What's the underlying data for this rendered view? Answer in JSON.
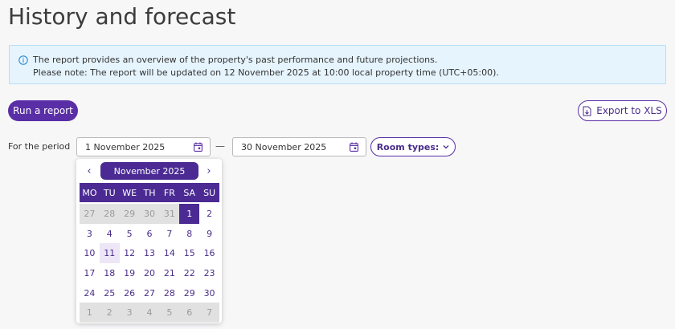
{
  "page": {
    "title": "History and forecast"
  },
  "info": {
    "line1": "The report provides an overview of the property's past performance and future projections.",
    "line2": "Please note: The report will be updated on 12 November 2025 at 10:00 local property time (UTC+05:00)."
  },
  "toolbar": {
    "run_label": "Run a report",
    "export_label": "Export to XLS"
  },
  "period": {
    "label": "For the period",
    "from": "1 November 2025",
    "separator": "—",
    "to": "30 November 2025",
    "room_types_label": "Room types:"
  },
  "calendar": {
    "prev": "‹",
    "next": "›",
    "month": "November 2025",
    "weekdays": [
      "MO",
      "TU",
      "WE",
      "TH",
      "FR",
      "SA",
      "SU"
    ],
    "days": [
      {
        "d": "27",
        "t": "other"
      },
      {
        "d": "28",
        "t": "other"
      },
      {
        "d": "29",
        "t": "other"
      },
      {
        "d": "30",
        "t": "other"
      },
      {
        "d": "31",
        "t": "other"
      },
      {
        "d": "1",
        "t": "selected"
      },
      {
        "d": "2",
        "t": ""
      },
      {
        "d": "3",
        "t": ""
      },
      {
        "d": "4",
        "t": ""
      },
      {
        "d": "5",
        "t": ""
      },
      {
        "d": "6",
        "t": ""
      },
      {
        "d": "7",
        "t": ""
      },
      {
        "d": "8",
        "t": ""
      },
      {
        "d": "9",
        "t": ""
      },
      {
        "d": "10",
        "t": ""
      },
      {
        "d": "11",
        "t": "today"
      },
      {
        "d": "12",
        "t": ""
      },
      {
        "d": "13",
        "t": ""
      },
      {
        "d": "14",
        "t": ""
      },
      {
        "d": "15",
        "t": ""
      },
      {
        "d": "16",
        "t": ""
      },
      {
        "d": "17",
        "t": ""
      },
      {
        "d": "18",
        "t": ""
      },
      {
        "d": "19",
        "t": ""
      },
      {
        "d": "20",
        "t": ""
      },
      {
        "d": "21",
        "t": ""
      },
      {
        "d": "22",
        "t": ""
      },
      {
        "d": "23",
        "t": ""
      },
      {
        "d": "24",
        "t": ""
      },
      {
        "d": "25",
        "t": ""
      },
      {
        "d": "26",
        "t": ""
      },
      {
        "d": "27",
        "t": ""
      },
      {
        "d": "28",
        "t": ""
      },
      {
        "d": "29",
        "t": ""
      },
      {
        "d": "30",
        "t": ""
      },
      {
        "d": "1",
        "t": "other"
      },
      {
        "d": "2",
        "t": "other"
      },
      {
        "d": "3",
        "t": "other"
      },
      {
        "d": "4",
        "t": "other"
      },
      {
        "d": "5",
        "t": "other"
      },
      {
        "d": "6",
        "t": "other"
      },
      {
        "d": "7",
        "t": "other"
      }
    ]
  },
  "colors": {
    "accent": "#5a2ea6",
    "calendar_header": "#4b2b93",
    "info_bg": "#e6f4fd",
    "info_border": "#b7dcf5"
  },
  "icons": {
    "info": "info-icon",
    "export": "export-file-icon",
    "calendar": "calendar-icon",
    "dropdown": "chevron-down-icon"
  }
}
